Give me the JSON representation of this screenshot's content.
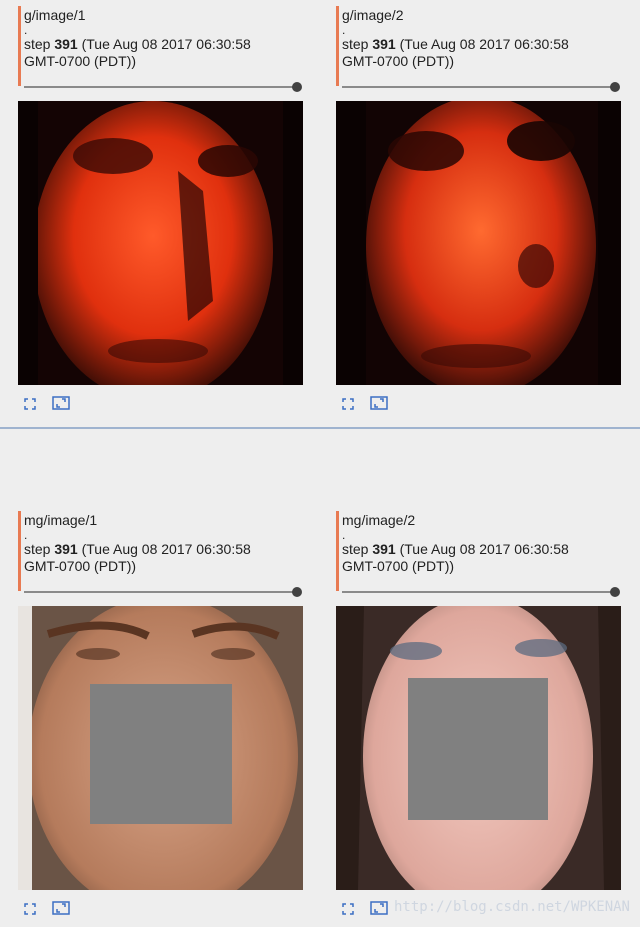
{
  "cards": [
    {
      "tag": "g/image/1",
      "dot": ".",
      "step_label": "step",
      "step_num": "391",
      "step_time": "(Tue Aug 08 2017 06:30:58",
      "step_tz": "GMT-0700 (PDT))"
    },
    {
      "tag": "g/image/2",
      "dot": ".",
      "step_label": "step",
      "step_num": "391",
      "step_time": "(Tue Aug 08 2017 06:30:58",
      "step_tz": "GMT-0700 (PDT))"
    },
    {
      "tag": "mg/image/1",
      "dot": ".",
      "step_label": "step",
      "step_num": "391",
      "step_time": "(Tue Aug 08 2017 06:30:58",
      "step_tz": "GMT-0700 (PDT))"
    },
    {
      "tag": "mg/image/2",
      "dot": ".",
      "step_label": "step",
      "step_num": "391",
      "step_time": "(Tue Aug 08 2017 06:30:58",
      "step_tz": "GMT-0700 (PDT))"
    }
  ],
  "icons": {
    "expand": "expand-icon",
    "actual_size": "actual-size-icon"
  },
  "colors": {
    "accent": "#e87a52",
    "divider": "#9fb3cf",
    "mask_gray": "#808080"
  },
  "watermark": "http://blog.csdn.net/WPKENAN"
}
